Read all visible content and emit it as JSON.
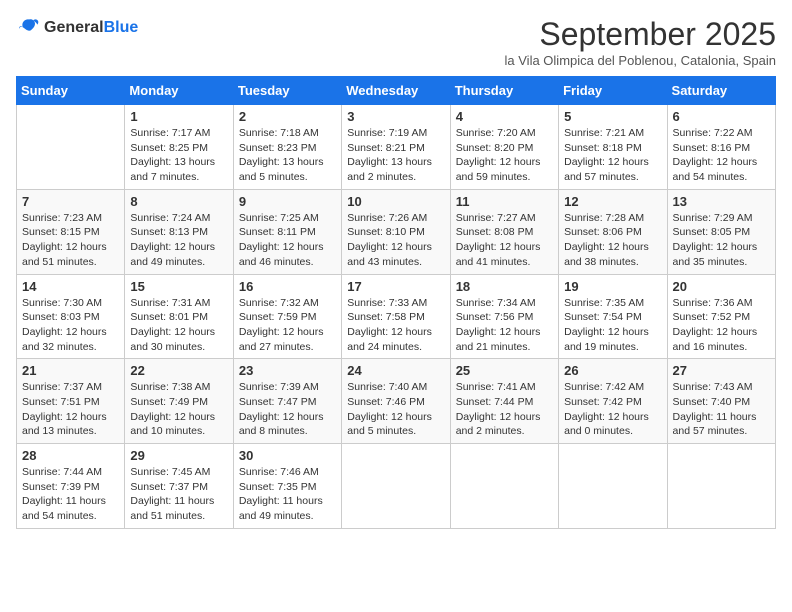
{
  "logo": {
    "text_general": "General",
    "text_blue": "Blue"
  },
  "title": "September 2025",
  "location": "la Vila Olimpica del Poblenou, Catalonia, Spain",
  "days_of_week": [
    "Sunday",
    "Monday",
    "Tuesday",
    "Wednesday",
    "Thursday",
    "Friday",
    "Saturday"
  ],
  "weeks": [
    [
      {
        "day": "",
        "info": ""
      },
      {
        "day": "1",
        "info": "Sunrise: 7:17 AM\nSunset: 8:25 PM\nDaylight: 13 hours\nand 7 minutes."
      },
      {
        "day": "2",
        "info": "Sunrise: 7:18 AM\nSunset: 8:23 PM\nDaylight: 13 hours\nand 5 minutes."
      },
      {
        "day": "3",
        "info": "Sunrise: 7:19 AM\nSunset: 8:21 PM\nDaylight: 13 hours\nand 2 minutes."
      },
      {
        "day": "4",
        "info": "Sunrise: 7:20 AM\nSunset: 8:20 PM\nDaylight: 12 hours\nand 59 minutes."
      },
      {
        "day": "5",
        "info": "Sunrise: 7:21 AM\nSunset: 8:18 PM\nDaylight: 12 hours\nand 57 minutes."
      },
      {
        "day": "6",
        "info": "Sunrise: 7:22 AM\nSunset: 8:16 PM\nDaylight: 12 hours\nand 54 minutes."
      }
    ],
    [
      {
        "day": "7",
        "info": "Sunrise: 7:23 AM\nSunset: 8:15 PM\nDaylight: 12 hours\nand 51 minutes."
      },
      {
        "day": "8",
        "info": "Sunrise: 7:24 AM\nSunset: 8:13 PM\nDaylight: 12 hours\nand 49 minutes."
      },
      {
        "day": "9",
        "info": "Sunrise: 7:25 AM\nSunset: 8:11 PM\nDaylight: 12 hours\nand 46 minutes."
      },
      {
        "day": "10",
        "info": "Sunrise: 7:26 AM\nSunset: 8:10 PM\nDaylight: 12 hours\nand 43 minutes."
      },
      {
        "day": "11",
        "info": "Sunrise: 7:27 AM\nSunset: 8:08 PM\nDaylight: 12 hours\nand 41 minutes."
      },
      {
        "day": "12",
        "info": "Sunrise: 7:28 AM\nSunset: 8:06 PM\nDaylight: 12 hours\nand 38 minutes."
      },
      {
        "day": "13",
        "info": "Sunrise: 7:29 AM\nSunset: 8:05 PM\nDaylight: 12 hours\nand 35 minutes."
      }
    ],
    [
      {
        "day": "14",
        "info": "Sunrise: 7:30 AM\nSunset: 8:03 PM\nDaylight: 12 hours\nand 32 minutes."
      },
      {
        "day": "15",
        "info": "Sunrise: 7:31 AM\nSunset: 8:01 PM\nDaylight: 12 hours\nand 30 minutes."
      },
      {
        "day": "16",
        "info": "Sunrise: 7:32 AM\nSunset: 7:59 PM\nDaylight: 12 hours\nand 27 minutes."
      },
      {
        "day": "17",
        "info": "Sunrise: 7:33 AM\nSunset: 7:58 PM\nDaylight: 12 hours\nand 24 minutes."
      },
      {
        "day": "18",
        "info": "Sunrise: 7:34 AM\nSunset: 7:56 PM\nDaylight: 12 hours\nand 21 minutes."
      },
      {
        "day": "19",
        "info": "Sunrise: 7:35 AM\nSunset: 7:54 PM\nDaylight: 12 hours\nand 19 minutes."
      },
      {
        "day": "20",
        "info": "Sunrise: 7:36 AM\nSunset: 7:52 PM\nDaylight: 12 hours\nand 16 minutes."
      }
    ],
    [
      {
        "day": "21",
        "info": "Sunrise: 7:37 AM\nSunset: 7:51 PM\nDaylight: 12 hours\nand 13 minutes."
      },
      {
        "day": "22",
        "info": "Sunrise: 7:38 AM\nSunset: 7:49 PM\nDaylight: 12 hours\nand 10 minutes."
      },
      {
        "day": "23",
        "info": "Sunrise: 7:39 AM\nSunset: 7:47 PM\nDaylight: 12 hours\nand 8 minutes."
      },
      {
        "day": "24",
        "info": "Sunrise: 7:40 AM\nSunset: 7:46 PM\nDaylight: 12 hours\nand 5 minutes."
      },
      {
        "day": "25",
        "info": "Sunrise: 7:41 AM\nSunset: 7:44 PM\nDaylight: 12 hours\nand 2 minutes."
      },
      {
        "day": "26",
        "info": "Sunrise: 7:42 AM\nSunset: 7:42 PM\nDaylight: 12 hours\nand 0 minutes."
      },
      {
        "day": "27",
        "info": "Sunrise: 7:43 AM\nSunset: 7:40 PM\nDaylight: 11 hours\nand 57 minutes."
      }
    ],
    [
      {
        "day": "28",
        "info": "Sunrise: 7:44 AM\nSunset: 7:39 PM\nDaylight: 11 hours\nand 54 minutes."
      },
      {
        "day": "29",
        "info": "Sunrise: 7:45 AM\nSunset: 7:37 PM\nDaylight: 11 hours\nand 51 minutes."
      },
      {
        "day": "30",
        "info": "Sunrise: 7:46 AM\nSunset: 7:35 PM\nDaylight: 11 hours\nand 49 minutes."
      },
      {
        "day": "",
        "info": ""
      },
      {
        "day": "",
        "info": ""
      },
      {
        "day": "",
        "info": ""
      },
      {
        "day": "",
        "info": ""
      }
    ]
  ]
}
